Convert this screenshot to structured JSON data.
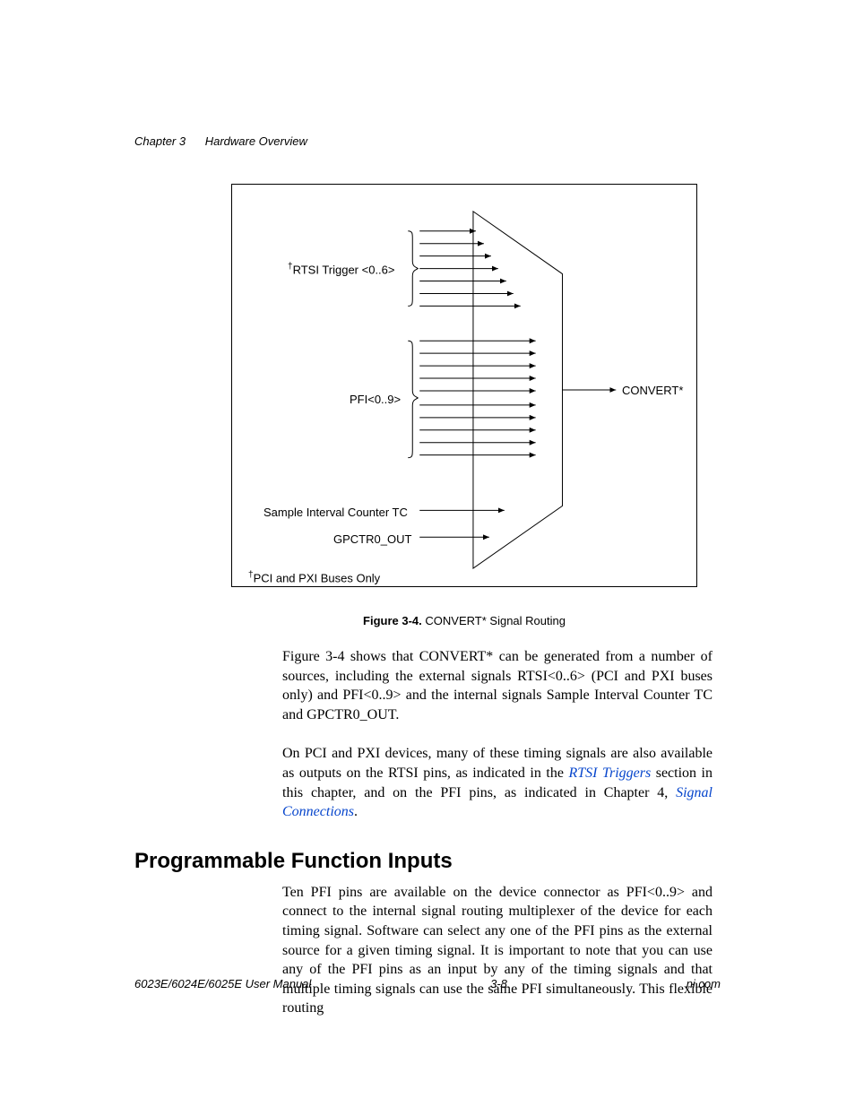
{
  "header": {
    "chapter": "Chapter 3",
    "title": "Hardware Overview"
  },
  "figure": {
    "labels": {
      "rtsi": "RTSI Trigger <0..6>",
      "pfi": "PFI<0..9>",
      "sample": "Sample Interval Counter TC",
      "gpctr": "GPCTR0_OUT",
      "output": "CONVERT*",
      "foot": "PCI and PXI Buses Only",
      "dagger": "†"
    },
    "caption_num": "Figure 3-4.",
    "caption_text": "CONVERT* Signal Routing"
  },
  "paragraphs": {
    "p1": "Figure  3-4 shows that CONVERT* can be generated from a number of sources, including the external signals RTSI<0..6> (PCI and PXI buses only) and PFI<0..9> and the internal signals Sample Interval Counter TC and GPCTR0_OUT.",
    "p2a": "On PCI and PXI devices, many of these timing signals are also available as outputs on the RTSI pins, as indicated in the ",
    "p2_link1": "RTSI Triggers",
    "p2b": " section in this chapter, and on the PFI pins, as indicated in Chapter 4, ",
    "p2_link2": "Signal Connections",
    "p2c": "."
  },
  "section_heading": "Programmable Function Inputs",
  "paragraphs2": {
    "p3": "Ten  PFI pins are available on the device connector as PFI<0..9> and connect to the internal signal routing multiplexer of the device for each timing signal. Software can select any one of the PFI pins as the external source for a given timing signal. It is important to note that you can use any of the PFI pins as an input by any of the timing signals and that multiple timing signals can use the same PFI simultaneously. This flexible routing"
  },
  "footer": {
    "left": "6023E/6024E/6025E User Manual",
    "center": "3-8",
    "right": "ni.com"
  }
}
